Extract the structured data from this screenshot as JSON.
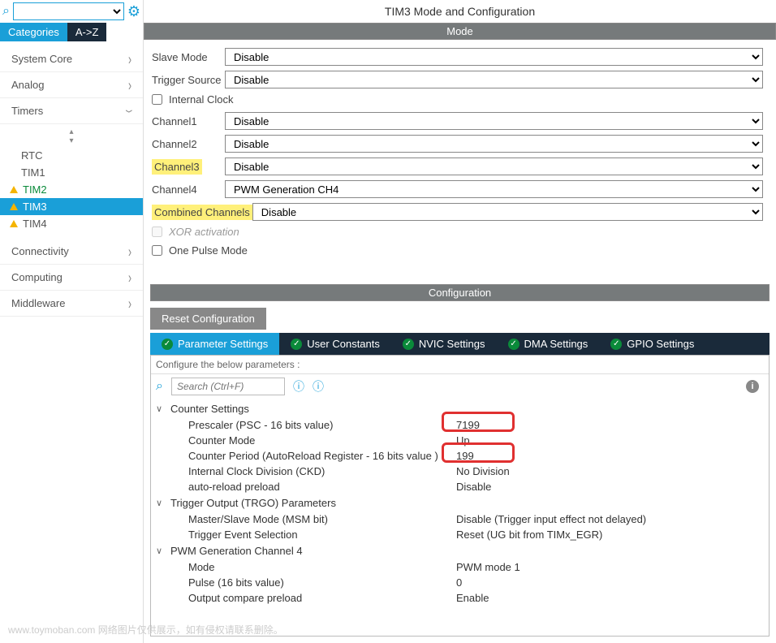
{
  "sidebar": {
    "tabs": {
      "categories": "Categories",
      "az": "A->Z"
    },
    "categories": [
      {
        "label": "System Core",
        "open": false
      },
      {
        "label": "Analog",
        "open": false
      },
      {
        "label": "Timers",
        "open": true
      },
      {
        "label": "Connectivity",
        "open": false
      },
      {
        "label": "Computing",
        "open": false
      },
      {
        "label": "Middleware",
        "open": false
      }
    ],
    "timers": [
      {
        "label": "RTC",
        "warn": false,
        "sel": false,
        "green": false
      },
      {
        "label": "TIM1",
        "warn": false,
        "sel": false,
        "green": false
      },
      {
        "label": "TIM2",
        "warn": true,
        "sel": false,
        "green": true
      },
      {
        "label": "TIM3",
        "warn": true,
        "sel": true,
        "green": false
      },
      {
        "label": "TIM4",
        "warn": true,
        "sel": false,
        "green": false
      }
    ]
  },
  "title": "TIM3 Mode and Configuration",
  "mode": {
    "header": "Mode",
    "rows": [
      {
        "label": "Slave Mode",
        "value": "Disable",
        "hl": false
      },
      {
        "label": "Trigger Source",
        "value": "Disable",
        "hl": false
      },
      {
        "label": "Channel1",
        "value": "Disable",
        "hl": false
      },
      {
        "label": "Channel2",
        "value": "Disable",
        "hl": false
      },
      {
        "label": "Channel3",
        "value": "Disable",
        "hl": true
      },
      {
        "label": "Channel4",
        "value": "PWM Generation CH4",
        "hl": false
      }
    ],
    "internal_clock": "Internal Clock",
    "combined": {
      "label": "Combined Channels",
      "value": "Disable"
    },
    "xor": "XOR activation",
    "one_pulse": "One Pulse Mode"
  },
  "config": {
    "header": "Configuration",
    "reset": "Reset Configuration",
    "tabs": [
      "Parameter Settings",
      "User Constants",
      "NVIC Settings",
      "DMA Settings",
      "GPIO Settings"
    ],
    "note": "Configure the below parameters :",
    "search_placeholder": "Search (Ctrl+F)",
    "groups": [
      {
        "name": "Counter Settings",
        "params": [
          {
            "key": "Prescaler (PSC - 16 bits value)",
            "val": "7199"
          },
          {
            "key": "Counter Mode",
            "val": "Up"
          },
          {
            "key": "Counter Period (AutoReload Register - 16 bits value )",
            "val": "199"
          },
          {
            "key": "Internal Clock Division (CKD)",
            "val": "No Division"
          },
          {
            "key": "auto-reload preload",
            "val": "Disable"
          }
        ]
      },
      {
        "name": "Trigger Output (TRGO) Parameters",
        "params": [
          {
            "key": "Master/Slave Mode (MSM bit)",
            "val": "Disable (Trigger input effect not delayed)"
          },
          {
            "key": "Trigger Event Selection",
            "val": "Reset (UG bit from TIMx_EGR)"
          }
        ]
      },
      {
        "name": "PWM Generation Channel 4",
        "params": [
          {
            "key": "Mode",
            "val": "PWM mode 1"
          },
          {
            "key": "Pulse (16 bits value)",
            "val": "0"
          },
          {
            "key": "Output compare preload",
            "val": "Enable"
          }
        ]
      }
    ]
  },
  "watermark": "www.toymoban.com  网络图片仅供展示，如有侵权请联系删除。"
}
